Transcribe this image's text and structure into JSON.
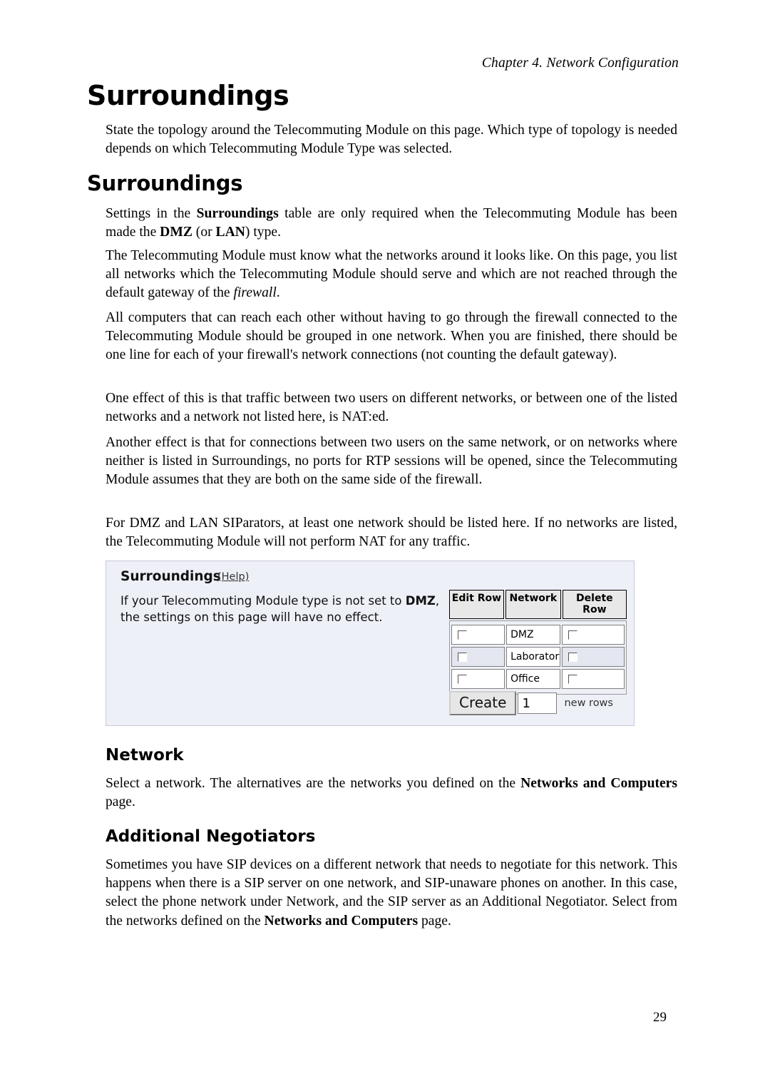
{
  "running_head": "Chapter 4. Network Configuration",
  "page_number": "29",
  "title": "Surroundings",
  "intro": "State the topology around the Telecommuting Module on this page. Which type of topology is needed depends on which Telecommuting Module Type was selected.",
  "section": {
    "heading": "Surroundings",
    "p1_prefix": "Settings in the ",
    "p1_bold1": "Surroundings",
    "p1_mid": " table are only required when the Telecommuting Module has been made the ",
    "p1_bold2": "DMZ",
    "p1_mid2": " (or ",
    "p1_bold3": "LAN",
    "p1_suffix": ") type.",
    "p2_a": "The Telecommuting Module must know what the networks around it looks like. On this page, you list all networks which the Telecommuting Module should serve and which are not reached through the default gateway of the ",
    "p2_italic": "firewall",
    "p2_b": ".",
    "p3": "All computers that can reach each other without having to go through the firewall connected to the Telecommuting Module should be grouped in one network. When you are finished, there should be one line for each of your firewall's network connections (not counting the default gateway).",
    "p4": "One effect of this is that traffic between two users on different networks, or between one of the listed networks and a network not listed here, is NAT:ed.",
    "p5": "Another effect is that for connections between two users on the same network, or on networks where neither is listed in Surroundings, no ports for RTP sessions will be opened, since the Telecommuting Module assumes that they are both on the same side of the firewall.",
    "p6": "For DMZ and LAN SIParators, at least one network should be listed here. If no networks are listed, the Telecommuting Module will not perform NAT for any traffic."
  },
  "figure": {
    "title": "Surroundings",
    "help_label": "(Help)",
    "note_a": "If your Telecommuting Module type is not set to ",
    "note_bold": "DMZ",
    "note_b": ", the settings on this page will have no effect.",
    "headers": [
      "Edit Row",
      "Network",
      "Delete Row"
    ],
    "rows": [
      {
        "network": "DMZ"
      },
      {
        "network": "Laboratory"
      },
      {
        "network": "Office"
      }
    ],
    "create_label": "Create",
    "create_count": "1",
    "new_rows_label": "new rows"
  },
  "network_section": {
    "heading": "Network",
    "p_a": "Select a network. The alternatives are the networks you defined on the ",
    "p_bold": "Networks and Computers",
    "p_b": " page."
  },
  "negotiators_section": {
    "heading": "Additional Negotiators",
    "p_a": "Sometimes you have SIP devices on a different network that needs to negotiate for this network. This happens when there is a SIP server on one network, and SIP-unaware phones on another. In this case, select the phone network under Network, and the SIP server as an Additional Negotiator. Select from the networks defined on the ",
    "p_bold": "Networks and Computers",
    "p_b": " page."
  }
}
